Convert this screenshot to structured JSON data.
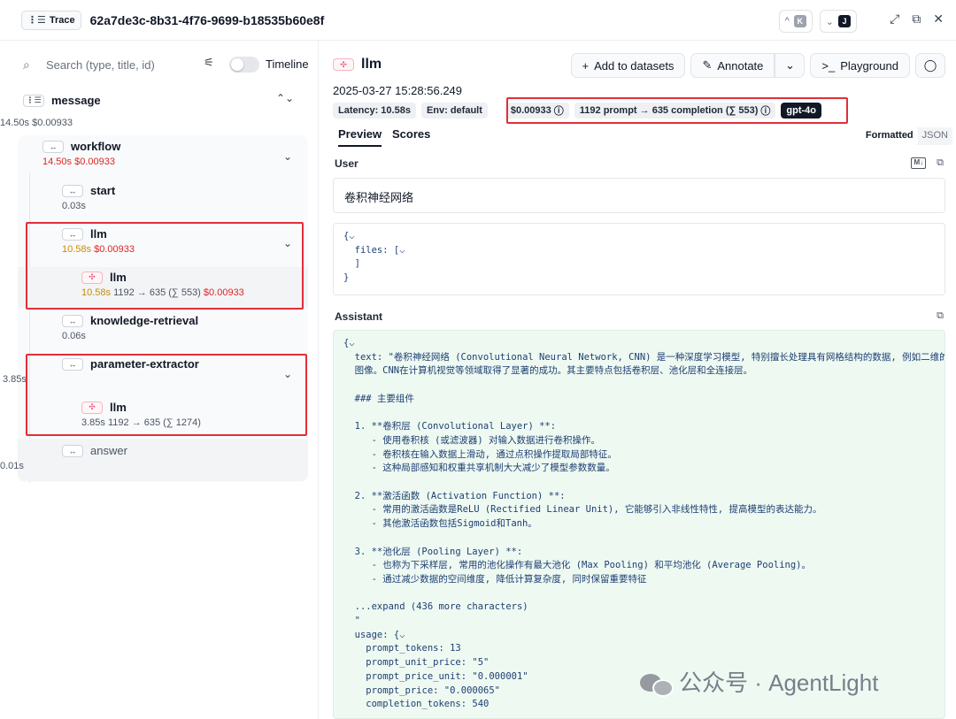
{
  "header": {
    "trace_label": "Trace",
    "trace_id": "62a7de3c-8b31-4f76-9699-b18535b60e8f",
    "prev_key": "K",
    "next_key": "J",
    "icons": [
      "expand-icon",
      "external-link-icon",
      "close-icon"
    ]
  },
  "sidebar": {
    "search_placeholder": "Search (type, title, id)",
    "timeline_label": "Timeline",
    "nodes": {
      "message": {
        "name": "message",
        "latency": "14.50s",
        "cost": "$0.00933"
      },
      "workflow": {
        "name": "workflow",
        "latency": "14.50s",
        "cost": "$0.00933"
      },
      "start": {
        "name": "start",
        "latency": "0.03s"
      },
      "llm_span": {
        "name": "llm",
        "latency": "10.58s",
        "cost": "$0.00933"
      },
      "llm_gen": {
        "name": "llm",
        "latency": "10.58s",
        "tokens": "1192 → 635 (∑ 553)",
        "cost": "$0.00933"
      },
      "knowledge": {
        "name": "knowledge-retrieval",
        "latency": "0.06s"
      },
      "param": {
        "name": "parameter-extractor",
        "latency": "3.85s"
      },
      "param_llm": {
        "name": "llm",
        "latency": "3.85s",
        "tokens": "1192 → 635 (∑ 1274)"
      },
      "answer": {
        "name": "answer",
        "latency": "0.01s"
      }
    }
  },
  "detail": {
    "title": "llm",
    "actions": {
      "add_to_datasets": "Add to datasets",
      "annotate": "Annotate",
      "playground": "Playground"
    },
    "timestamp": "2025-03-27 15:28:56.249",
    "chips": {
      "latency": "Latency: 10.58s",
      "env": "Env: default",
      "cost": "$0.00933",
      "tokens": "1192 prompt → 635 completion (∑ 553)",
      "model": "gpt-4o"
    },
    "tabs": {
      "preview": "Preview",
      "scores": "Scores"
    },
    "format": {
      "formatted": "Formatted",
      "json": "JSON"
    },
    "user": {
      "heading": "User",
      "text": "卷积神经网络",
      "json": "{⌵\n  files: [⌵\n  ]\n}"
    },
    "assistant": {
      "heading": "Assistant",
      "json": "{⌵\n  text: \"卷积神经网络 (Convolutional Neural Network, CNN) 是一种深度学习模型, 特别擅长处理具有网格结构的数据, 例如二维的\n  图像。CNN在计算机视觉等领域取得了显著的成功。其主要特点包括卷积层、池化层和全连接层。\n\n  ### 主要组件\n\n  1. **卷积层 (Convolutional Layer) **:\n     - 使用卷积核 (或滤波器) 对输入数据进行卷积操作。\n     - 卷积核在输入数据上滑动, 通过点积操作提取局部特征。\n     - 这种局部感知和权重共享机制大大减少了模型参数数量。\n\n  2. **激活函数 (Activation Function) **:\n     - 常用的激活函数是ReLU (Rectified Linear Unit), 它能够引入非线性特性, 提高模型的表达能力。\n     - 其他激活函数包括Sigmoid和Tanh。\n\n  3. **池化层 (Pooling Layer) **:\n     - 也称为下采样层, 常用的池化操作有最大池化 (Max Pooling) 和平均池化 (Average Pooling)。\n     - 通过减少数据的空间维度, 降低计算复杂度, 同时保留重要特征\n\n  ...expand (436 more characters)\n  \"\n  usage: {⌵\n    prompt_tokens: 13\n    prompt_unit_price: \"5\"\n    prompt_price_unit: \"0.000001\"\n    prompt_price: \"0.000065\"\n    completion_tokens: 540"
    }
  },
  "watermark": {
    "text": "公众号 · AgentLight"
  }
}
